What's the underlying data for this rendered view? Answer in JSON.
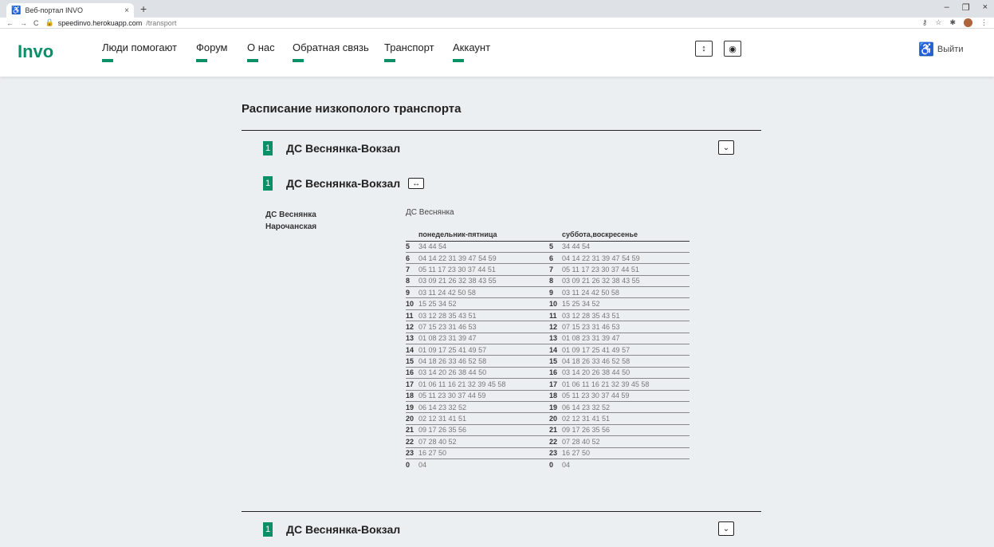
{
  "browser": {
    "tab_title": "Веб-портал INVO",
    "tab_close": "×",
    "new_tab": "+",
    "url_host": "speedinvo.herokuapp.com",
    "url_path": "/transport",
    "min": "–",
    "max": "❐",
    "close": "×"
  },
  "nav": {
    "logo": "Invo",
    "items": [
      "Люди помогают",
      "Форум",
      "О нас",
      "Обратная связь",
      "Транспорт",
      "Аккаунт"
    ],
    "logout": "Выйти"
  },
  "page": {
    "title": "Расписание низкополого транспорта",
    "routes": [
      {
        "num": "1",
        "name": "ДС Веснянка-Вокзал"
      },
      {
        "num": "1",
        "name": "ДС Веснянка-Вокзал"
      },
      {
        "num": "1",
        "name": "ДС Веснянка-Вокзал"
      }
    ],
    "stops": [
      "ДС Веснянка",
      "Нарочанская"
    ],
    "selected_stop": "ДС Веснянка",
    "col_weekday": "понедельник-пятница",
    "col_weekend": "суббота,воскресенье",
    "schedule": [
      [
        "5",
        "34 44 54"
      ],
      [
        "6",
        "04 14 22 31 39 47 54 59"
      ],
      [
        "7",
        "05 11 17 23 30 37 44 51"
      ],
      [
        "8",
        "03 09 21 26 32 38 43 55"
      ],
      [
        "9",
        "03 11 24 42 50 58"
      ],
      [
        "10",
        "15 25 34 52"
      ],
      [
        "11",
        "03 12 28 35 43 51"
      ],
      [
        "12",
        "07 15 23 31 46 53"
      ],
      [
        "13",
        "01 08 23 31 39 47"
      ],
      [
        "14",
        "01 09 17 25 41 49 57"
      ],
      [
        "15",
        "04 18 26 33 46 52 58"
      ],
      [
        "16",
        "03 14 20 26 38 44 50"
      ],
      [
        "17",
        "01 06 11 16 21 32 39 45 58"
      ],
      [
        "18",
        "05 11 23 30 37 44 59"
      ],
      [
        "19",
        "06 14 23 32 52"
      ],
      [
        "20",
        "02 12 31 41 51"
      ],
      [
        "21",
        "09 17 26 35 56"
      ],
      [
        "22",
        "07 28 40 52"
      ],
      [
        "23",
        "16 27 50"
      ],
      [
        "0",
        "04"
      ]
    ]
  }
}
